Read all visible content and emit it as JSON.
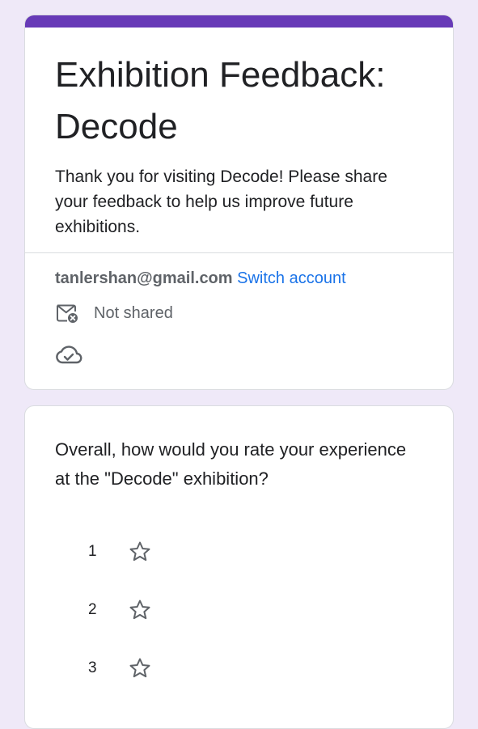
{
  "form": {
    "accent_color": "#673ab7",
    "title": "Exhibition Feedback: Decode",
    "description": "Thank you for visiting Decode! Please share your feedback to help us improve future exhibitions.",
    "account": {
      "email": "tanlershan@gmail.com",
      "switch_label": "Switch account"
    },
    "shared_status": "Not shared",
    "icons": {
      "shared": "mail-not-shared-icon",
      "saved": "cloud-saved-icon"
    }
  },
  "question": {
    "text": "Overall, how would you rate your experience at the \"Decode\" exhibition?",
    "options": [
      {
        "label": "1",
        "icon": "star-outline-icon"
      },
      {
        "label": "2",
        "icon": "star-outline-icon"
      },
      {
        "label": "3",
        "icon": "star-outline-icon"
      }
    ]
  }
}
